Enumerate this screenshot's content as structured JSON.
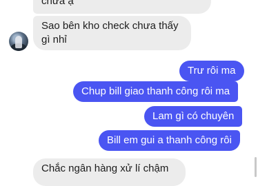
{
  "messages": [
    {
      "direction": "incoming",
      "text": "chưa ạ"
    },
    {
      "direction": "incoming",
      "text": "Sao bên kho check chưa thấy gì nhỉ"
    },
    {
      "direction": "outgoing",
      "text": "Trư rôi ma"
    },
    {
      "direction": "outgoing",
      "text": "Chup bill giao thanh công rôi ma"
    },
    {
      "direction": "outgoing",
      "text": "Lam gì có chuyên"
    },
    {
      "direction": "outgoing",
      "text": "Bill em gui a thanh công rôi"
    },
    {
      "direction": "incoming",
      "text": "Chắc ngân hàng xử lí chậm"
    }
  ],
  "colors": {
    "incoming_bubble": "#ececec",
    "outgoing_bubble": "#4a55f2",
    "background": "#ffffff"
  },
  "icons": {
    "sender_avatar": "avatar"
  }
}
